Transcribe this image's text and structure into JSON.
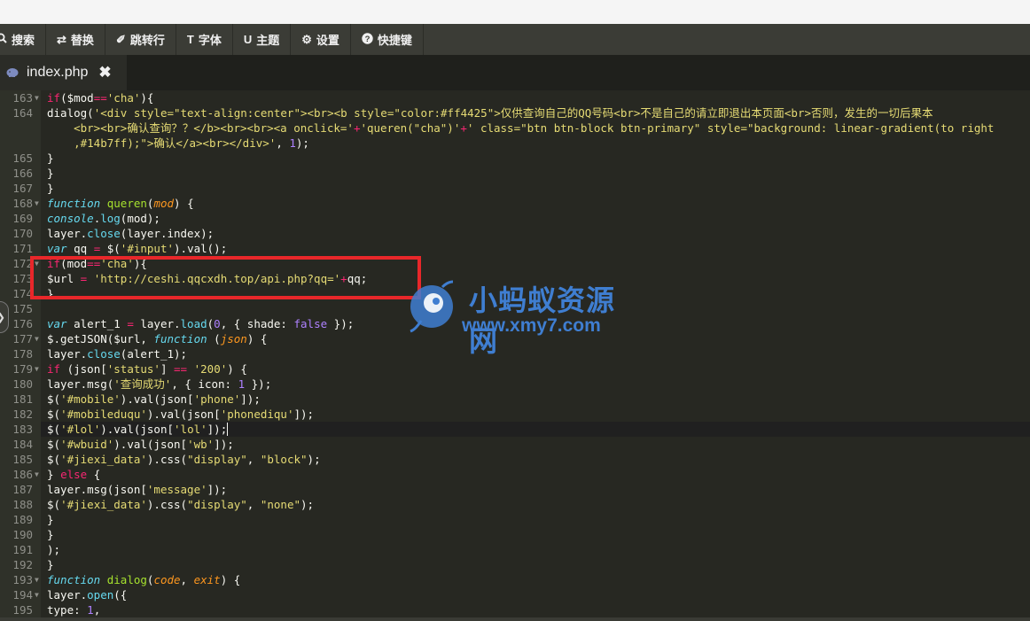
{
  "toolbar": {
    "items": [
      {
        "icon": "search-icon",
        "label": "搜索"
      },
      {
        "icon": "replace-icon",
        "label": "替换"
      },
      {
        "icon": "jump-icon",
        "label": "跳转行"
      },
      {
        "icon": "font-icon",
        "label": "字体"
      },
      {
        "icon": "theme-icon",
        "label": "主题"
      },
      {
        "icon": "gear-icon",
        "label": "设置"
      },
      {
        "icon": "help-icon",
        "label": "快捷键"
      }
    ]
  },
  "tab": {
    "filename": "index.php",
    "close_glyph": "✖"
  },
  "editor": {
    "side_toggle": "❯",
    "line_numbers": [
      "163",
      "164",
      "",
      "",
      "165",
      "166",
      "167",
      "168",
      "169",
      "170",
      "171",
      "172",
      "173",
      "174",
      "175",
      "176",
      "177",
      "178",
      "179",
      "180",
      "181",
      "182",
      "183",
      "184",
      "185",
      "186",
      "187",
      "188",
      "189",
      "190",
      "191",
      "192",
      "193",
      "194",
      "195"
    ],
    "active_line_number": "183"
  },
  "watermark": {
    "title": "小蚂蚁资源网",
    "url": "www.xmy7.com"
  },
  "colors": {
    "background": "#272822",
    "highlight_box": "#e8272a",
    "watermark": "#3f7ed1"
  }
}
